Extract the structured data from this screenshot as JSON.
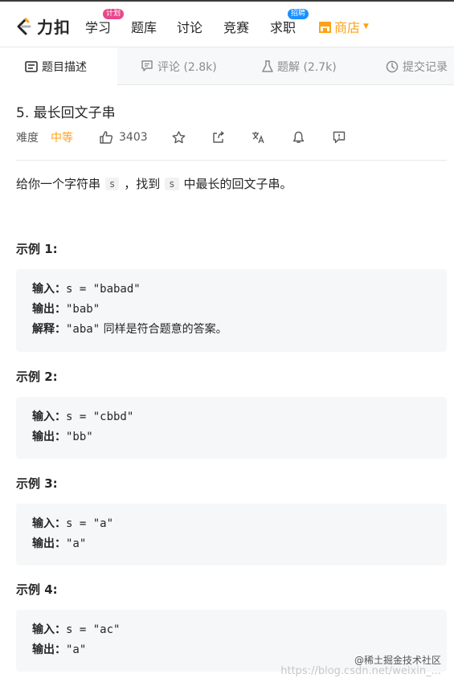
{
  "nav": {
    "logo_text": "力扣",
    "items": [
      {
        "label": "学习",
        "badge": "计划"
      },
      {
        "label": "题库"
      },
      {
        "label": "讨论"
      },
      {
        "label": "竞赛"
      },
      {
        "label": "求职",
        "badge": "招聘"
      }
    ],
    "store_label": "商店",
    "accent_color": "#ffa116"
  },
  "tabs": [
    {
      "label": "题目描述",
      "icon": "description-icon",
      "active": true
    },
    {
      "label": "评论 (2.8k)",
      "icon": "comment-icon"
    },
    {
      "label": "题解 (2.7k)",
      "icon": "flask-icon"
    },
    {
      "label": "提交记录",
      "icon": "clock-icon"
    }
  ],
  "problem": {
    "title": "5. 最长回文子串",
    "difficulty_label": "难度",
    "difficulty": "中等",
    "likes": "3403",
    "action_icons": [
      "thumbs-up-icon",
      "star-icon",
      "share-icon",
      "translate-icon",
      "bell-icon",
      "feedback-icon"
    ]
  },
  "description": {
    "part1": "给你一个字符串",
    "code1": "s",
    "part2": "，找到",
    "code2": "s",
    "part3": "中最长的回文子串。"
  },
  "examples": [
    {
      "title": "示例 1:",
      "lines": [
        {
          "key": "输入：",
          "value": "s = \"babad\""
        },
        {
          "key": "输出：",
          "value": "\"bab\""
        },
        {
          "key": "解释：",
          "value": "\"aba\"",
          "note": " 同样是符合题意的答案。"
        }
      ]
    },
    {
      "title": "示例 2:",
      "lines": [
        {
          "key": "输入：",
          "value": "s = \"cbbd\""
        },
        {
          "key": "输出：",
          "value": "\"bb\""
        }
      ]
    },
    {
      "title": "示例 3:",
      "lines": [
        {
          "key": "输入：",
          "value": "s = \"a\""
        },
        {
          "key": "输出：",
          "value": "\"a\""
        }
      ]
    },
    {
      "title": "示例 4:",
      "lines": [
        {
          "key": "输入：",
          "value": "s = \"ac\""
        },
        {
          "key": "输出：",
          "value": "\"a\""
        }
      ]
    }
  ],
  "watermark": {
    "line1": "@稀土掘金技术社区",
    "line2": "https://blog.csdn.net/weixin_..."
  }
}
